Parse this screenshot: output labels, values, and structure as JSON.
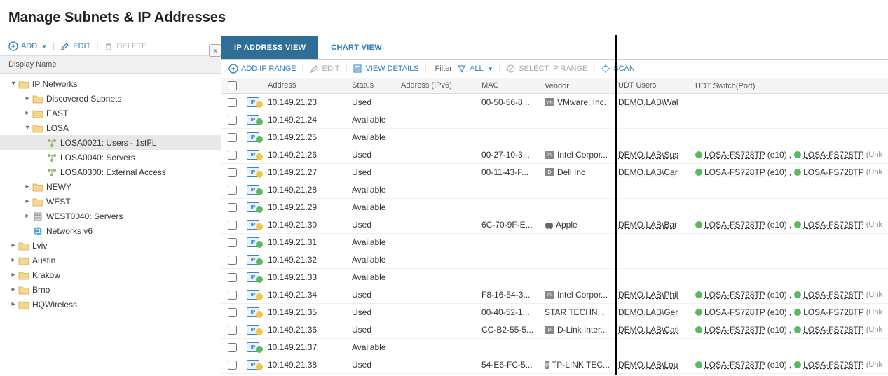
{
  "page_title": "Manage Subnets & IP Addresses",
  "sidebar": {
    "toolbar": {
      "add": "ADD",
      "edit": "EDIT",
      "delete": "DELETE"
    },
    "header": "Display Name",
    "tree": [
      {
        "label": "IP Networks",
        "indent": 0,
        "toggle": "▾",
        "icon": "folder",
        "name": "tree-ip-networks"
      },
      {
        "label": "Discovered Subnets",
        "indent": 1,
        "toggle": "▸",
        "icon": "folder",
        "name": "tree-discovered-subnets"
      },
      {
        "label": "EAST",
        "indent": 1,
        "toggle": "▸",
        "icon": "folder",
        "name": "tree-east"
      },
      {
        "label": "LOSA",
        "indent": 1,
        "toggle": "▾",
        "icon": "folder-open",
        "name": "tree-losa"
      },
      {
        "label": "LOSA0021: Users - 1stFL",
        "indent": 2,
        "toggle": "",
        "icon": "subnet",
        "name": "tree-losa0021",
        "selected": true
      },
      {
        "label": "LOSA0040: Servers",
        "indent": 2,
        "toggle": "",
        "icon": "subnet",
        "name": "tree-losa0040"
      },
      {
        "label": "LOSA0300: External Access",
        "indent": 2,
        "toggle": "",
        "icon": "subnet",
        "name": "tree-losa0300"
      },
      {
        "label": "NEWY",
        "indent": 1,
        "toggle": "▸",
        "icon": "folder",
        "name": "tree-newy"
      },
      {
        "label": "WEST",
        "indent": 1,
        "toggle": "▸",
        "icon": "folder",
        "name": "tree-west"
      },
      {
        "label": "WEST0040: Servers",
        "indent": 1,
        "toggle": "▸",
        "icon": "server",
        "name": "tree-west0040"
      },
      {
        "label": "Networks v6",
        "indent": 1,
        "toggle": "",
        "icon": "globe",
        "name": "tree-networks-v6"
      },
      {
        "label": "Lviv",
        "indent": 0,
        "toggle": "▸",
        "icon": "folder",
        "name": "tree-lviv"
      },
      {
        "label": "Austin",
        "indent": 0,
        "toggle": "▸",
        "icon": "folder",
        "name": "tree-austin"
      },
      {
        "label": "Krakow",
        "indent": 0,
        "toggle": "▸",
        "icon": "folder",
        "name": "tree-krakow"
      },
      {
        "label": "Brno",
        "indent": 0,
        "toggle": "▸",
        "icon": "folder",
        "name": "tree-brno"
      },
      {
        "label": "HQWireless",
        "indent": 0,
        "toggle": "▸",
        "icon": "folder",
        "name": "tree-hqwireless"
      }
    ]
  },
  "tabs": {
    "ip_view": "IP ADDRESS VIEW",
    "chart_view": "CHART VIEW"
  },
  "main_toolbar": {
    "add_ip_range": "ADD IP RANGE",
    "edit": "EDIT",
    "view_details": "VIEW DETAILS",
    "filter_label": "Filter:",
    "filter_value": "ALL",
    "select_ip_range": "SELECT IP RANGE",
    "scan": "SCAN"
  },
  "grid": {
    "headers": {
      "address": "Address",
      "status": "Status",
      "ipv6": "Address (IPv6)",
      "mac": "MAC",
      "vendor": "Vendor",
      "udt_users": "UDT Users",
      "udt_switch": "UDT Switch(Port)"
    },
    "rows": [
      {
        "addr": "10.149.21.23",
        "status": "Used",
        "mac": "00-50-56-8...",
        "vendor": "VMware, Inc.",
        "vlogo": "vm",
        "user": "DEMO.LAB\\Wal",
        "switch": ""
      },
      {
        "addr": "10.149.21.24",
        "status": "Available",
        "mac": "",
        "vendor": "",
        "vlogo": "",
        "user": "",
        "switch": ""
      },
      {
        "addr": "10.149.21.25",
        "status": "Available",
        "mac": "",
        "vendor": "",
        "vlogo": "",
        "user": "",
        "switch": ""
      },
      {
        "addr": "10.149.21.26",
        "status": "Used",
        "mac": "00-27-10-3...",
        "vendor": "Intel Corpor...",
        "vlogo": "intel",
        "user": "DEMO.LAB\\Sus",
        "switch": "yes"
      },
      {
        "addr": "10.149.21.27",
        "status": "Used",
        "mac": "00-11-43-F...",
        "vendor": "Dell Inc",
        "vlogo": "dell",
        "user": "DEMO.LAB\\Car",
        "switch": "yes"
      },
      {
        "addr": "10.149.21.28",
        "status": "Available",
        "mac": "",
        "vendor": "",
        "vlogo": "",
        "user": "",
        "switch": ""
      },
      {
        "addr": "10.149.21.29",
        "status": "Available",
        "mac": "",
        "vendor": "",
        "vlogo": "",
        "user": "",
        "switch": ""
      },
      {
        "addr": "10.149.21.30",
        "status": "Used",
        "mac": "6C-70-9F-E...",
        "vendor": "Apple",
        "vlogo": "apple",
        "user": "DEMO.LAB\\Bar",
        "switch": "yes"
      },
      {
        "addr": "10.149.21.31",
        "status": "Available",
        "mac": "",
        "vendor": "",
        "vlogo": "",
        "user": "",
        "switch": ""
      },
      {
        "addr": "10.149.21.32",
        "status": "Available",
        "mac": "",
        "vendor": "",
        "vlogo": "",
        "user": "",
        "switch": ""
      },
      {
        "addr": "10.149.21.33",
        "status": "Available",
        "mac": "",
        "vendor": "",
        "vlogo": "",
        "user": "",
        "switch": ""
      },
      {
        "addr": "10.149.21.34",
        "status": "Used",
        "mac": "F8-16-54-3...",
        "vendor": "Intel Corpor...",
        "vlogo": "intel",
        "user": "DEMO.LAB\\Phil",
        "switch": "yes"
      },
      {
        "addr": "10.149.21.35",
        "status": "Used",
        "mac": "00-40-52-1...",
        "vendor": "STAR TECHN...",
        "vlogo": "",
        "user": "DEMO.LAB\\Ger",
        "switch": "yes"
      },
      {
        "addr": "10.149.21.36",
        "status": "Used",
        "mac": "CC-B2-55-5...",
        "vendor": "D-Link Inter...",
        "vlogo": "dlink",
        "user": "DEMO.LAB\\Catl",
        "switch": "yes"
      },
      {
        "addr": "10.149.21.37",
        "status": "Available",
        "mac": "",
        "vendor": "",
        "vlogo": "",
        "user": "",
        "switch": ""
      },
      {
        "addr": "10.149.21.38",
        "status": "Used",
        "mac": "54-E6-FC-5...",
        "vendor": "TP-LINK TEC...",
        "vlogo": "tplink",
        "user": "DEMO.LAB\\Lou",
        "switch": "yes"
      }
    ],
    "switch_link": "LOSA-FS728TP",
    "switch_port": "(e10)",
    "switch_unk": "(Unk"
  }
}
